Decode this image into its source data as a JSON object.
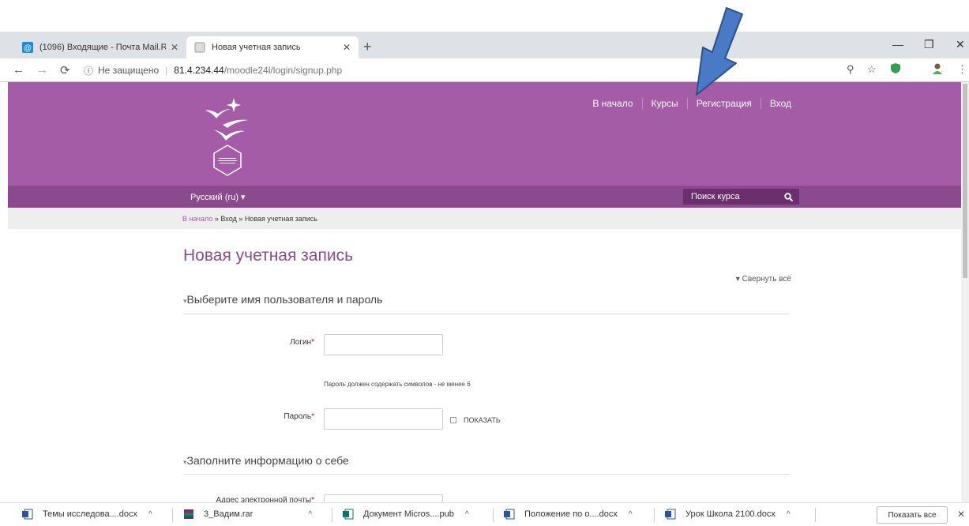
{
  "browser": {
    "tabs": [
      {
        "title": "(1096) Входящие - Почта Mail.R",
        "active": false
      },
      {
        "title": "Новая учетная запись",
        "active": true
      }
    ],
    "new_tab": "+",
    "address": {
      "security": "Не защищено",
      "host": "81.4.234.44",
      "path": "/moodle24l/login/signup.php"
    }
  },
  "site": {
    "menu": [
      "В начало",
      "Курсы",
      "Регистрация",
      "Вход"
    ],
    "language": "Русский (ru) ▾",
    "search_placeholder": "Поиск курса",
    "breadcrumb": {
      "home": "В начало",
      "sep": "»",
      "login": "Вход",
      "current": "Новая учетная запись"
    }
  },
  "form": {
    "title": "Новая учетная запись",
    "collapse_all": "▾ Свернуть всё",
    "section1": "Выберите имя пользователя и пароль",
    "login_label": "Логин",
    "password_hint": "Пароль должен содержать символов - не менее 6",
    "password_label": "Пароль",
    "show_label": "ПОКАЗАТЬ",
    "section2": "Заполните информацию о себе",
    "email_label": "Адрес электронной почты",
    "required_mark": "*"
  },
  "downloads": {
    "items": [
      {
        "name": "Темы исследова....docx",
        "icon": "word-doc-icon"
      },
      {
        "name": "3_Вадим.rar",
        "icon": "rar-archive-icon"
      },
      {
        "name": "Документ Micros....pub",
        "icon": "publisher-doc-icon"
      },
      {
        "name": "Положение по о....docx",
        "icon": "word-doc-icon"
      },
      {
        "name": "Урок Школа 2100.docx",
        "icon": "word-doc-icon"
      }
    ],
    "show_all": "Показать все"
  },
  "colors": {
    "brand": "#a45ca6",
    "brand_dark": "#8b4a8d",
    "arrow": "#4a7ac6"
  }
}
